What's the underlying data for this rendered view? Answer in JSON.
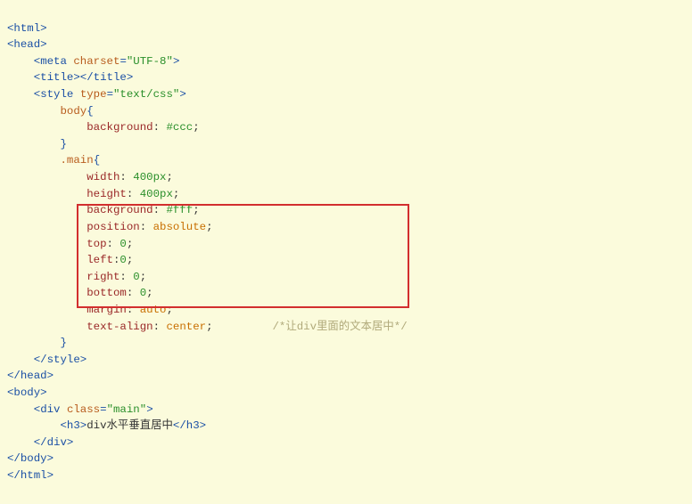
{
  "code": {
    "l1": "<html>",
    "l2": "<head>",
    "l3a": "    <",
    "l3b": "meta",
    "l3c": " ",
    "l3d": "charset",
    "l3e": "=",
    "l3f": "\"UTF-8\"",
    "l3g": ">",
    "l4": "    <title></title>",
    "l5a": "    <",
    "l5b": "style",
    "l5c": " ",
    "l5d": "type",
    "l5e": "=",
    "l5f": "\"text/css\"",
    "l5g": ">",
    "l6": "        body",
    "l6b": "{",
    "l7a": "            ",
    "l7b": "background",
    "l7c": ": ",
    "l7d": "#ccc",
    "l7e": ";",
    "l8": "        }",
    "l9a": "        ",
    "l9b": ".main",
    "l9c": "{",
    "l10a": "            ",
    "l10b": "width",
    "l10c": ": ",
    "l10d": "400px",
    "l10e": ";",
    "l11a": "            ",
    "l11b": "height",
    "l11c": ": ",
    "l11d": "400px",
    "l11e": ";",
    "l12a": "            ",
    "l12b": "background",
    "l12c": ": ",
    "l12d": "#fff",
    "l12e": ";",
    "l13a": "            ",
    "l13b": "position",
    "l13c": ": ",
    "l13d": "absolute",
    "l13e": ";",
    "l14a": "            ",
    "l14b": "top",
    "l14c": ": ",
    "l14d": "0",
    "l14e": ";",
    "l15a": "            ",
    "l15b": "left",
    "l15c": ":",
    "l15d": "0",
    "l15e": ";",
    "l16a": "            ",
    "l16b": "right",
    "l16c": ": ",
    "l16d": "0",
    "l16e": ";",
    "l17a": "            ",
    "l17b": "bottom",
    "l17c": ": ",
    "l17d": "0",
    "l17e": ";",
    "l18a": "            ",
    "l18b": "margin",
    "l18c": ": ",
    "l18d": "auto",
    "l18e": ";",
    "l19a": "            ",
    "l19b": "text-align",
    "l19c": ": ",
    "l19d": "center",
    "l19e": ";",
    "l19f": "         ",
    "l19g": "/*让div里面的文本居中*/",
    "l20": "        }",
    "l21": "    </style>",
    "l22": "</head>",
    "l23": "<body>",
    "l24a": "    <",
    "l24b": "div",
    "l24c": " ",
    "l24d": "class",
    "l24e": "=",
    "l24f": "\"main\"",
    "l24g": ">",
    "l25a": "        <h3>",
    "l25b": "div水平垂直居中",
    "l25c": "</h3>",
    "l26": "    </div>",
    "l27": "</body>",
    "l28": "</html>"
  }
}
